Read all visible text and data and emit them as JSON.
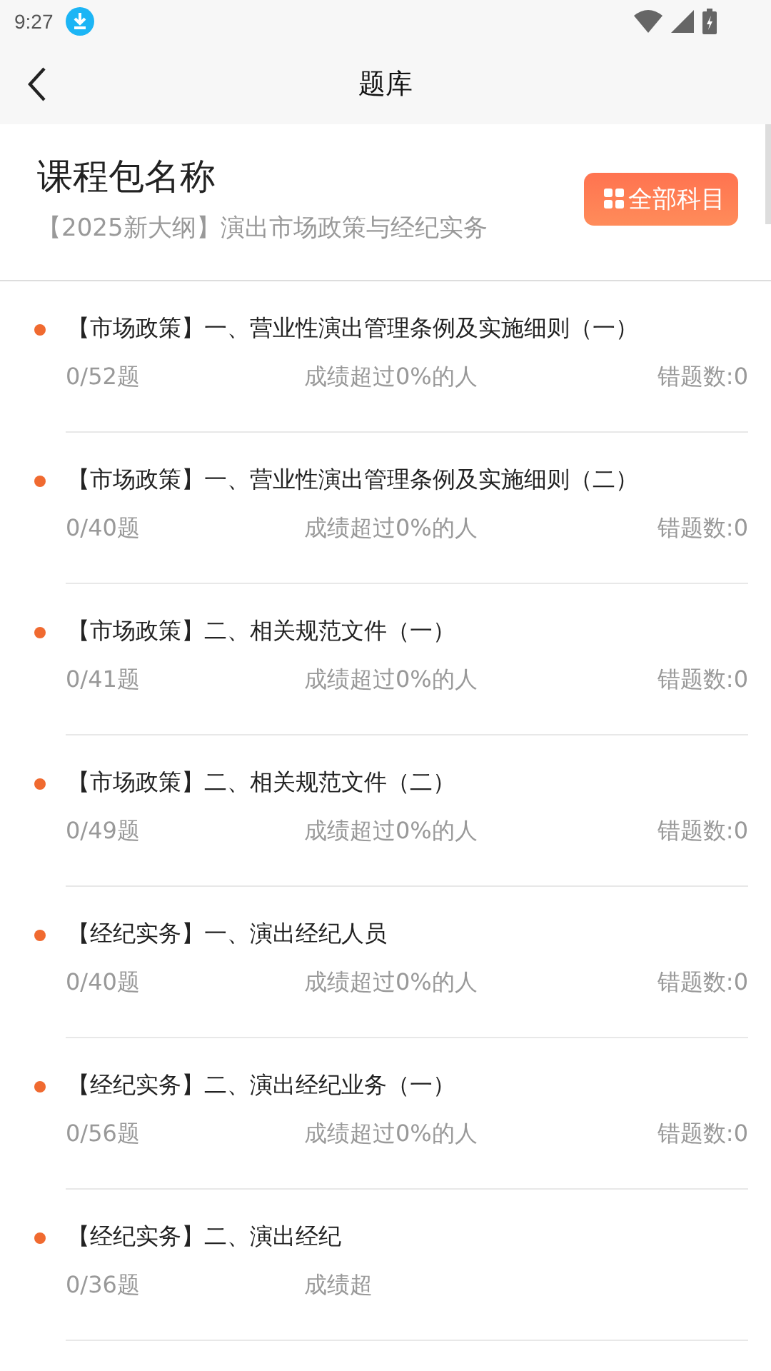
{
  "status_bar": {
    "time": "9:27"
  },
  "nav": {
    "title": "题库"
  },
  "course": {
    "name": "课程包名称",
    "subtitle": "【2025新大纲】演出市场政策与经纪实务",
    "button": "全部科目"
  },
  "chapters": [
    {
      "title": "【市场政策】一、营业性演出管理条例及实施细则（一）",
      "progress": "0/52题",
      "rank": "成绩超过0%的人",
      "wrong": "错题数:0"
    },
    {
      "title": "【市场政策】一、营业性演出管理条例及实施细则（二）",
      "progress": "0/40题",
      "rank": "成绩超过0%的人",
      "wrong": "错题数:0"
    },
    {
      "title": "【市场政策】二、相关规范文件（一）",
      "progress": "0/41题",
      "rank": "成绩超过0%的人",
      "wrong": "错题数:0"
    },
    {
      "title": "【市场政策】二、相关规范文件（二）",
      "progress": "0/49题",
      "rank": "成绩超过0%的人",
      "wrong": "错题数:0"
    },
    {
      "title": "【经纪实务】一、演出经纪人员",
      "progress": "0/40题",
      "rank": "成绩超过0%的人",
      "wrong": "错题数:0"
    },
    {
      "title": "【经纪实务】二、演出经纪业务（一）",
      "progress": "0/56题",
      "rank": "成绩超过0%的人",
      "wrong": "错题数:0"
    },
    {
      "title": "【经纪实务】二、演出经纪",
      "progress": "0/36题",
      "rank": "成绩超"
    }
  ]
}
